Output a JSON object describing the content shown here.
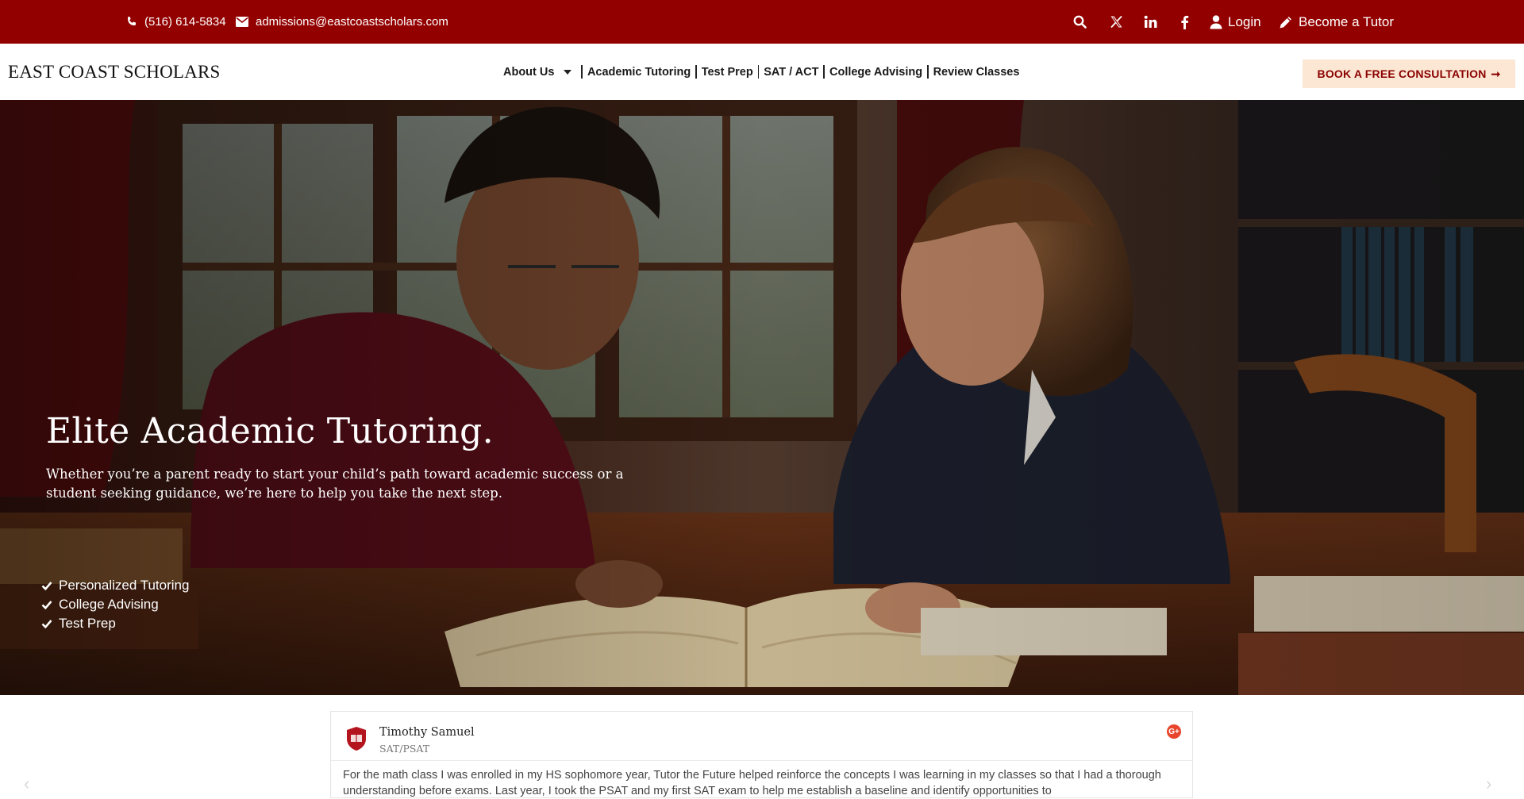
{
  "topbar": {
    "phone": "(516) 614-5834",
    "email": "admissions@eastcoastscholars.com",
    "login_label": "Login",
    "tutor_label": "Become a Tutor",
    "icons": [
      "phone-icon",
      "envelope-icon",
      "search-icon",
      "x-twitter-icon",
      "linkedin-icon",
      "facebook-icon",
      "user-icon",
      "pencil-icon"
    ]
  },
  "header": {
    "logo": "EAST COAST SCHOLARS",
    "nav": [
      {
        "label": "About Us"
      },
      {
        "label": "Academic Tutoring"
      },
      {
        "label": "Test Prep"
      },
      {
        "label": "SAT / ACT"
      },
      {
        "label": "College Advising"
      },
      {
        "label": "Review Classes"
      }
    ],
    "cta_label": "BOOK A FREE CONSULTATION",
    "cta_arrow": "➞"
  },
  "hero": {
    "title": "Elite Academic Tutoring.",
    "subtitle": "Whether you’re a parent ready to start your child’s path toward academic success or a student seeking guidance, we’re here to help you take the next step.",
    "features": [
      "Personalized Tutoring",
      "College Advising",
      "Test Prep"
    ]
  },
  "review": {
    "name": "Timothy Samuel",
    "tag": "SAT/PSAT",
    "badge": "G+",
    "text": "For the math class I was enrolled in my HS sophomore year, Tutor the Future helped reinforce the concepts I was learning in my classes so that I had a thorough understanding before exams. Last year, I took the PSAT and my first SAT exam to help me establish a baseline and identify opportunities to"
  },
  "colors": {
    "topbar": "#930000",
    "cta_bg": "#fbe7d3",
    "cta_text": "#8b0000"
  }
}
